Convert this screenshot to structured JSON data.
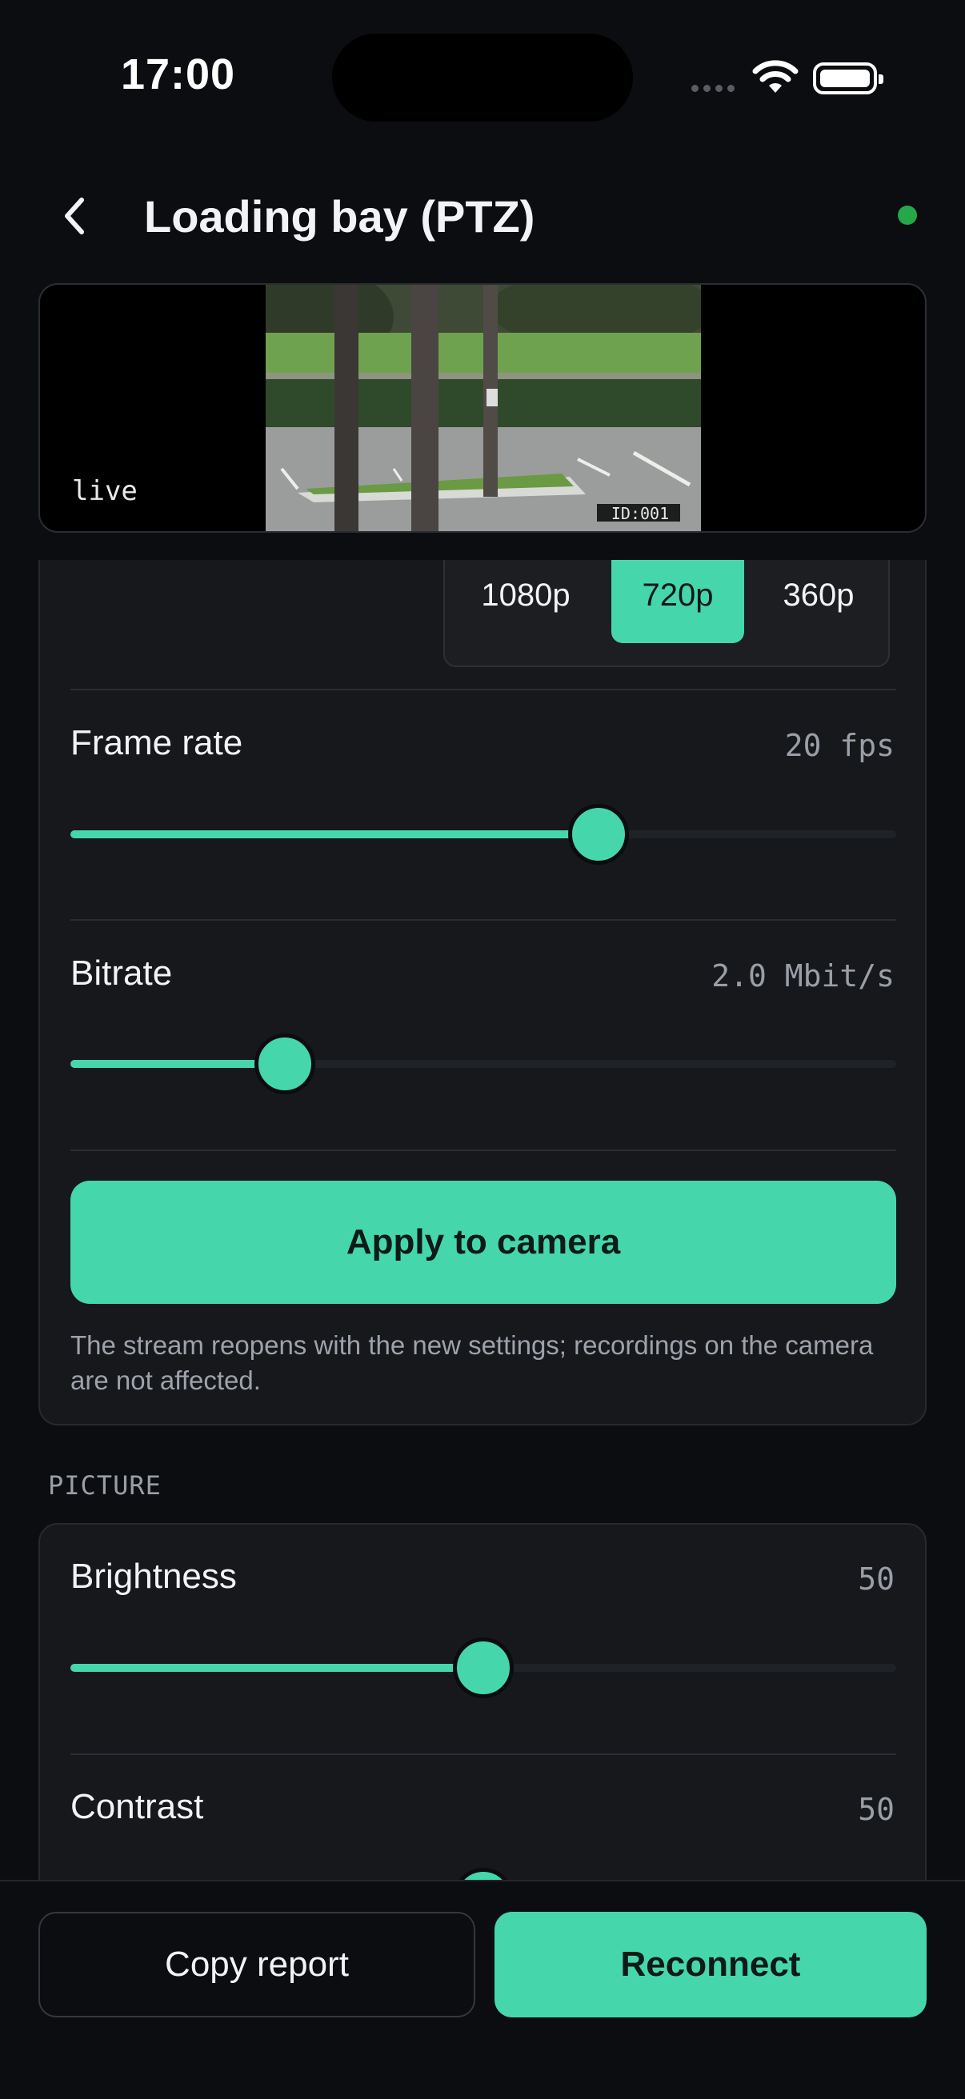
{
  "status_bar": {
    "time": "17:00"
  },
  "header": {
    "title": "Loading bay (PTZ)",
    "connection_color": "#23a84a"
  },
  "preview": {
    "badge": "live",
    "camera_osd": "ID:001"
  },
  "stream": {
    "resolution_options": [
      "1080p",
      "720p",
      "360p"
    ],
    "resolution_selected": "720p",
    "frame_rate": {
      "label": "Frame rate",
      "value": "20 fps",
      "level": 0.64
    },
    "bitrate": {
      "label": "Bitrate",
      "value": "2.0 Mbit/s",
      "level": 0.26
    },
    "apply_label": "Apply to camera",
    "note": "The stream reopens with the new settings; recordings on the camera are not affected."
  },
  "picture": {
    "section_label": "PICTURE",
    "brightness": {
      "label": "Brightness",
      "value": "50",
      "level": 0.5
    },
    "contrast": {
      "label": "Contrast",
      "value": "50",
      "level": 0.5
    }
  },
  "actions": {
    "copy_label": "Copy report",
    "reconnect_label": "Reconnect"
  },
  "colors": {
    "accent": "#46d6ac",
    "background": "#0c0d10",
    "card": "#16181c"
  }
}
